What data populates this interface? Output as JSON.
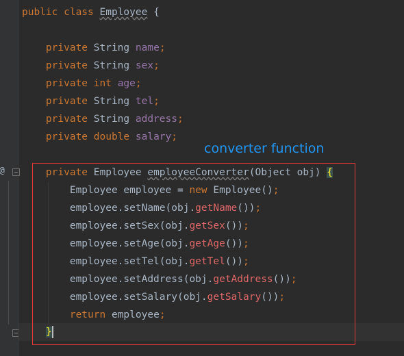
{
  "editor": {
    "annotation": "converter function",
    "gutter_marker": "@",
    "colors": {
      "background": "#2b2b2b",
      "keyword": "#cc7832",
      "field": "#9876aa",
      "method": "#e06767",
      "annotation": "#2196f3",
      "highlight_border": "#e53935"
    }
  },
  "code": {
    "class_decl": {
      "kw": "public class",
      "name": "Employee",
      "brace": "{"
    },
    "fields": [
      {
        "mod": "private",
        "type": "String",
        "name": "name"
      },
      {
        "mod": "private",
        "type": "String",
        "name": "sex"
      },
      {
        "mod": "private",
        "type": "int",
        "name": "age"
      },
      {
        "mod": "private",
        "type": "String",
        "name": "tel"
      },
      {
        "mod": "private",
        "type": "String",
        "name": "address"
      },
      {
        "mod": "private",
        "type": "double",
        "name": "salary"
      }
    ],
    "method_decl": {
      "mod": "private",
      "ret_type": "Employee",
      "name": "employeeConverter",
      "params": "(Object obj) ",
      "brace": "{"
    },
    "new_line": {
      "prefix": "Employee employee = ",
      "kw": "new",
      "suffix": " Employee()"
    },
    "setters": [
      {
        "call": "employee.setName(obj.",
        "getter": "getName",
        "close": "())"
      },
      {
        "call": "employee.setSex(obj.",
        "getter": "getSex",
        "close": "())"
      },
      {
        "call": "employee.setAge(obj.",
        "getter": "getAge",
        "close": "())"
      },
      {
        "call": "employee.setTel(obj.",
        "getter": "getTel",
        "close": "())"
      },
      {
        "call": "employee.setAddress(obj.",
        "getter": "getAddress",
        "close": "())"
      },
      {
        "call": "employee.setSalary(obj.",
        "getter": "getSalary",
        "close": "())"
      }
    ],
    "return_line": {
      "kw": "return",
      "value": " employee"
    },
    "closing_brace": "}"
  }
}
